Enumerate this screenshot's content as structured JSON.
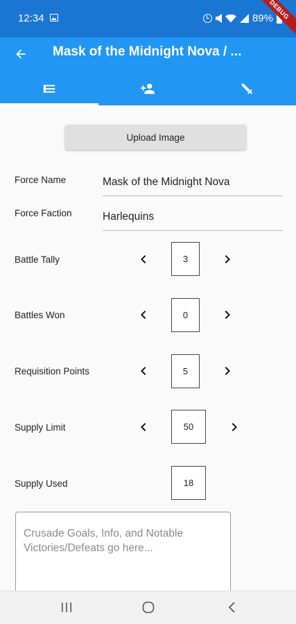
{
  "status_bar": {
    "time": "12:34",
    "battery": "89%"
  },
  "debug_banner": "DEBUG",
  "app_bar": {
    "title": "Mask of the Midnight Nova / ..."
  },
  "tabs": [
    {
      "icon": "list-icon",
      "selected": true
    },
    {
      "icon": "person-add-icon",
      "selected": false
    },
    {
      "icon": "sword-icon",
      "selected": false
    }
  ],
  "upload_button": {
    "label": "Upload Image"
  },
  "force_name": {
    "label": "Force Name",
    "value": "Mask of the Midnight Nova"
  },
  "force_faction": {
    "label": "Force Faction",
    "value": "Harlequins"
  },
  "battle_tally": {
    "label": "Battle Tally",
    "value": "3"
  },
  "battles_won": {
    "label": "Battles Won",
    "value": "0"
  },
  "requisition_points": {
    "label": "Requisition Points",
    "value": "5"
  },
  "supply_limit": {
    "label": "Supply Limit",
    "value": "50"
  },
  "supply_used": {
    "label": "Supply Used",
    "value": "18"
  },
  "notes": {
    "placeholder": "Crusade Goals, Info, and Notable Victories/Defeats go here..."
  },
  "colors": {
    "status_bar": "#1976d2",
    "app_bar": "#2196f3",
    "debug": "#b71c1c"
  }
}
